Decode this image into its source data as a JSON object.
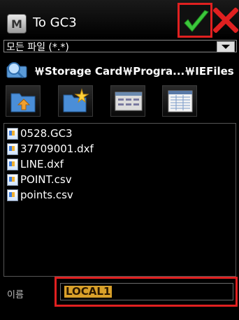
{
  "window": {
    "title": "To GC3",
    "app_icon_letter": "M"
  },
  "filter": {
    "selected": "모든 파일 (*.*)"
  },
  "path": "￦Storage Card￦Progra...￦IEFiles",
  "toolbar": {
    "icons": [
      "folder-up-icon",
      "new-folder-icon",
      "list-view-icon",
      "detail-view-icon"
    ]
  },
  "files": [
    {
      "name": "0528.GC3"
    },
    {
      "name": "37709001.dxf"
    },
    {
      "name": "LINE.dxf"
    },
    {
      "name": "POINT.csv"
    },
    {
      "name": "points.csv"
    }
  ],
  "name_field": {
    "label": "이름",
    "value": "LOCAL1"
  },
  "colors": {
    "highlight_border": "#e02020",
    "selection": "#d9a12a",
    "ok_check": "#3cc83c",
    "cancel_x": "#e02020"
  }
}
